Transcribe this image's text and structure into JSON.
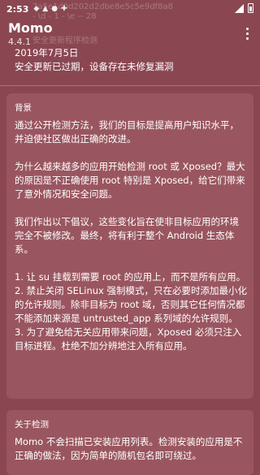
{
  "status_bar": {
    "time": "2:53",
    "notification_icons": [
      "notification-icon-1",
      "notification-icon-2",
      "notification-icon-3",
      "notification-icon-4"
    ],
    "system_icons": [
      "signal-icon",
      "battery-icon"
    ]
  },
  "ghost_lines": {
    "line1": "7a5e1d0d202d2dbe8e5c5e9df8a8",
    "line2": "- \\d - 1 - \\e -- 28",
    "line3": "安全更新程序检测"
  },
  "app_bar": {
    "title": "Momo",
    "version": "4.4.1",
    "menu_icon": "overflow-menu-icon"
  },
  "security": {
    "date": "2019年7月5日",
    "warning": "安全更新已过期，设备存在未修复漏洞"
  },
  "background_card": {
    "title": "背景",
    "paragraphs": [
      "通过公开检测方法，我们的目标是提高用户知识水平，并迫使社区做出正确的改进。",
      "为什么越来越多的应用开始检测 root 或 Xposed？最大的原因是不正确使用 root 特别是 Xposed，给它们带来了意外情况和安全问题。",
      "我们作出以下倡议，这些变化旨在使非目标应用的环境完全不被修改。最终，将有利于整个 Android 生态体系。",
      "1. 让 su 挂载到需要 root 的应用上，而不是所有应用。\n2. 禁止关闭 SELinux 强制模式，只在必要时添加最小化的允许规则。除非目标为 root 域，否则其它任何情况都不能添加来源是 untrusted_app 系列域的允许规则。\n3. 为了避免给无关应用带来问题，Xposed 必须只注入目标进程。杜绝不加分辨地注入所有应用。"
    ]
  },
  "detection_card": {
    "title": "关于检测",
    "paragraphs": [
      "Momo 不会扫描已安装应用列表。检测安装的应用是不正确的做法，因为简单的随机包名即可绕过。"
    ]
  },
  "colors": {
    "background": "#8a4752",
    "card": "#9a5660",
    "text": "#ffffff"
  }
}
